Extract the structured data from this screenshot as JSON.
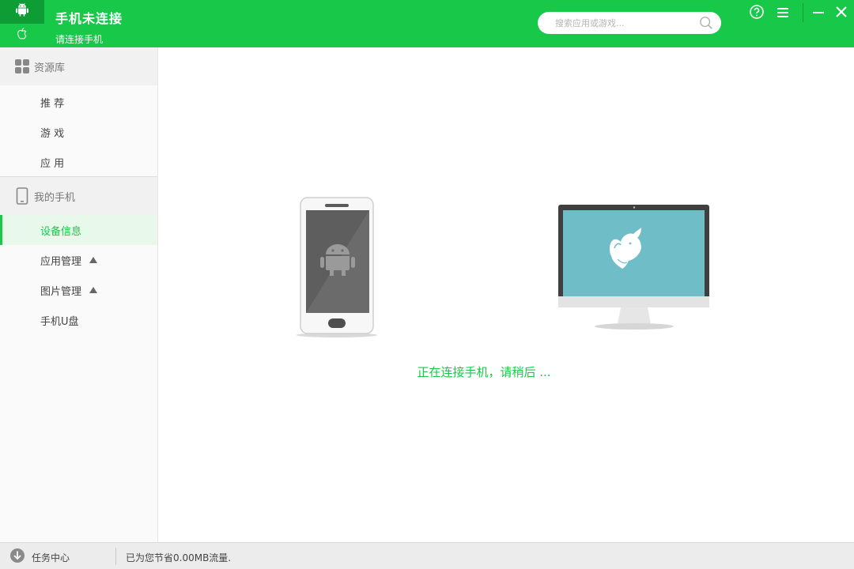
{
  "header": {
    "connection_title": "手机未连接",
    "connection_subtitle": "请连接手机",
    "platform_tabs": [
      {
        "name": "android",
        "icon": "android-icon",
        "active": true
      },
      {
        "name": "apple",
        "icon": "apple-icon",
        "active": false
      }
    ],
    "search": {
      "placeholder": "搜索应用或游戏..."
    },
    "window_controls": [
      "help-icon",
      "menu-icon",
      "minimize-icon",
      "close-icon"
    ]
  },
  "sidebar": {
    "resource_section": {
      "label": "资源库",
      "icon": "grid-icon",
      "items": [
        {
          "label": "推 荐"
        },
        {
          "label": "游 戏"
        },
        {
          "label": "应 用"
        }
      ]
    },
    "phone_section": {
      "label": "我的手机",
      "icon": "phone-icon",
      "items": [
        {
          "label": "设备信息",
          "active": true
        },
        {
          "label": "应用管理",
          "caret": true
        },
        {
          "label": "图片管理",
          "caret": true
        },
        {
          "label": "手机U盘"
        }
      ]
    }
  },
  "main": {
    "status_message": "正在连接手机，请稍后 ..."
  },
  "statusbar": {
    "task_center_label": "任务中心",
    "saved_traffic": "已为您节省0.00MB流量."
  },
  "colors": {
    "brand_green": "#18c849",
    "dark_green": "#0e9c34",
    "monitor_screen": "#6fbdc6"
  }
}
